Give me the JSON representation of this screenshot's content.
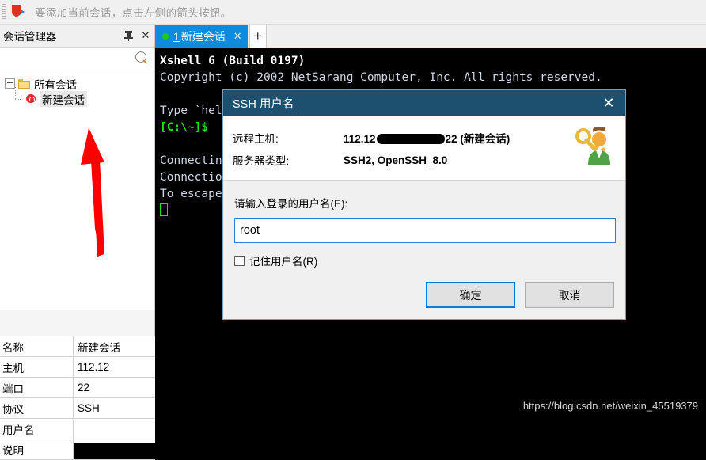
{
  "notification": {
    "icon": "redirect-arrow-icon",
    "text": "要添加当前会话，点击左侧的箭头按钮。"
  },
  "session_manager": {
    "title": "会话管理器",
    "pin_icon": "pin-icon",
    "close_icon": "close-icon",
    "search_icon": "search-icon",
    "tree": {
      "root": "所有会话",
      "child": "新建会话"
    },
    "properties": [
      {
        "key": "名称",
        "value": "新建会话"
      },
      {
        "key": "主机",
        "value": "112.12"
      },
      {
        "key": "端口",
        "value": "22"
      },
      {
        "key": "协议",
        "value": "SSH"
      },
      {
        "key": "用户名",
        "value": ""
      },
      {
        "key": "说明",
        "value": ""
      }
    ]
  },
  "tabs": {
    "active": {
      "index": "1",
      "label": "新建会话",
      "status_dot": "connected",
      "close_icon": "close-icon"
    },
    "new_tab_label": "+"
  },
  "terminal": {
    "lines": [
      "Xshell 6 (Build 0197)",
      "Copyright (c) 2002 NetSarang Computer, Inc. All rights reserved.",
      "",
      "Type `help' to learn how to use Xshell prompt.",
      "[C:\\~]$ ",
      "",
      "Connecting",
      "Connection",
      "To escape"
    ],
    "prompt": "[C:\\~]$"
  },
  "dialog": {
    "title": "SSH 用户名",
    "close_icon": "close-icon",
    "icon": "key-user-icon",
    "info": [
      {
        "key": "远程主机:",
        "value_prefix": "112.12",
        "value_suffix": "22 (新建会话)",
        "redacted": true
      },
      {
        "key": "服务器类型:",
        "value_prefix": "SSH2, OpenSSH_8.0",
        "value_suffix": "",
        "redacted": false
      }
    ],
    "field_label": "请输入登录的用户名(E):",
    "field_value": "root",
    "checkbox_label": "记住用户名(R)",
    "checkbox_checked": false,
    "ok_label": "确定",
    "cancel_label": "取消"
  },
  "watermark": "https://blog.csdn.net/weixin_45519379",
  "colors": {
    "tab_active": "#0d8bdf",
    "dialog_title": "#1d4f6e",
    "focus_blue": "#0a7bd4",
    "annotation_red": "#ff0000",
    "terminal_bg": "#000000"
  }
}
